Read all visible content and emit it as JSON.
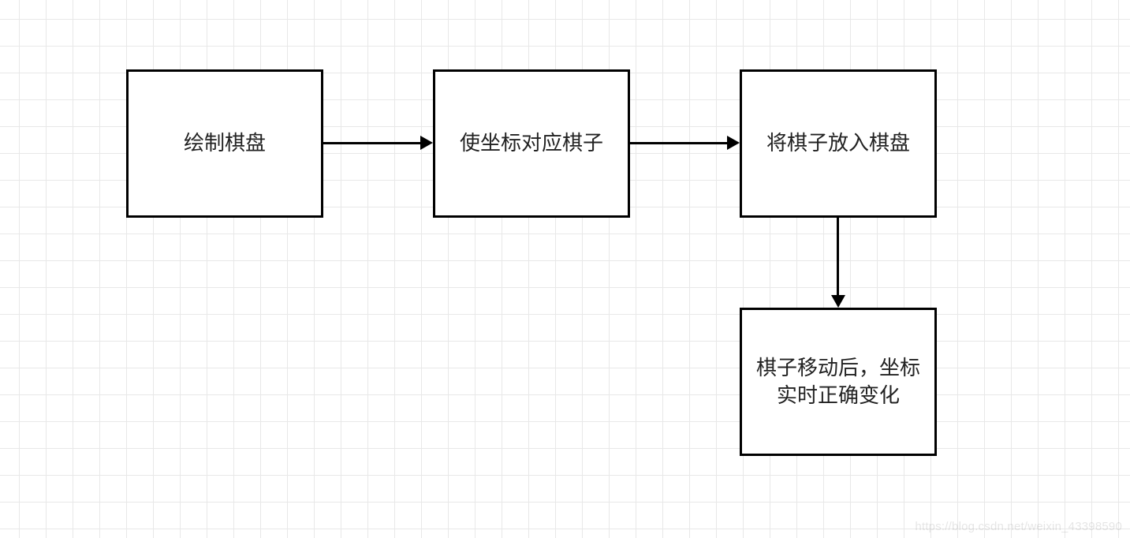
{
  "nodes": {
    "n1": {
      "label": "绘制棋盘"
    },
    "n2": {
      "label": "使坐标对应棋子"
    },
    "n3": {
      "label": "将棋子放入棋盘"
    },
    "n4": {
      "label": "棋子移动后，坐标实时正确变化"
    }
  },
  "watermark": "https://blog.csdn.net/weixin_43398590"
}
